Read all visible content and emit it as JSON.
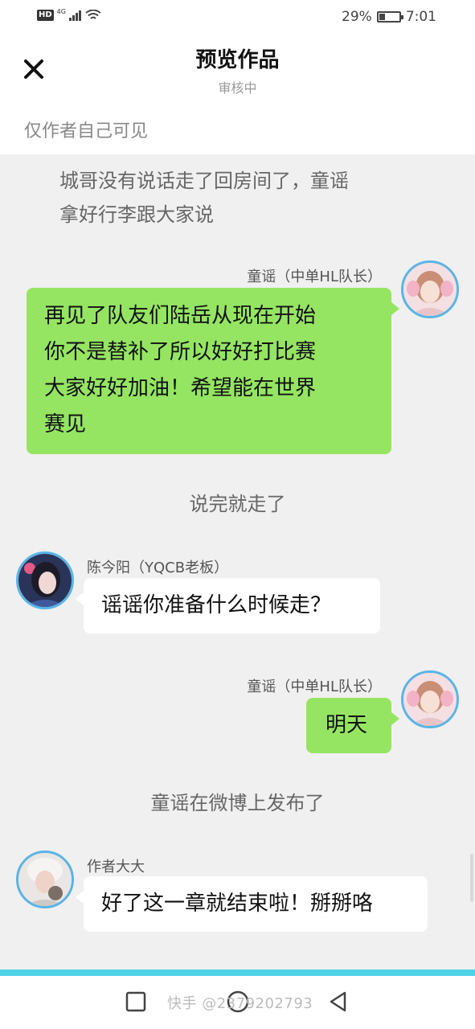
{
  "status_bar": {
    "hd": "HD",
    "network": "4G",
    "battery_percent": "29%",
    "battery_level": 0.29,
    "time": "7:01"
  },
  "header": {
    "close_icon": "close-icon",
    "title": "预览作品",
    "subtitle": "审核中"
  },
  "visibility_note": "仅作者自己可见",
  "chat": {
    "narration_1_line1": "城哥没有说话走了回房间了，童谣",
    "narration_1_line2": "拿好行李跟大家说",
    "message_1": {
      "speaker": "童谣（中单HL队长）",
      "lines": [
        "再见了队友们陆岳从现在开始",
        "你不是替补了所以好好打比赛",
        "大家好好加油！希望能在世界",
        "赛见"
      ]
    },
    "narration_2": "说完就走了",
    "message_2": {
      "speaker": "陈今阳（YQCB老板）",
      "text": "谣谣你准备什么时候走？"
    },
    "message_3": {
      "speaker": "童谣（中单HL队长）",
      "text": "明天"
    },
    "narration_3": "童谣在微博上发布了",
    "message_4": {
      "speaker": "作者大大",
      "text": "好了这一章就结束啦！掰掰咯"
    }
  },
  "nav": {
    "recent_icon": "square-icon",
    "home_icon": "circle-icon",
    "back_icon": "triangle-back-icon",
    "watermark": "快手 @2379202793"
  },
  "colors": {
    "green_bubble": "#95e562",
    "avatar_ring": "#5ab4e6",
    "accent_line": "#4fd3e6",
    "chat_bg": "#f0f0f0"
  }
}
